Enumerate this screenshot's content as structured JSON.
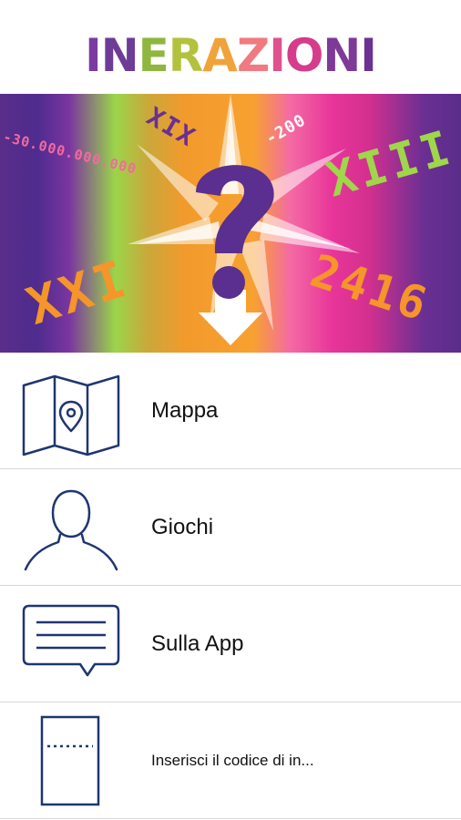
{
  "app": {
    "logo_text": "INERAZIONI",
    "logo_letters": [
      {
        "ch": "I",
        "color": "#7a3aa0"
      },
      {
        "ch": "N",
        "color": "#6d3c97"
      },
      {
        "ch": "E",
        "color": "#8fb63f"
      },
      {
        "ch": "R",
        "color": "#b3c23d"
      },
      {
        "ch": "A",
        "color": "#f0a33b"
      },
      {
        "ch": "Z",
        "color": "#f07a7f"
      },
      {
        "ch": "I",
        "color": "#e0528f"
      },
      {
        "ch": "O",
        "color": "#d53d8c"
      },
      {
        "ch": "N",
        "color": "#7d3a98"
      },
      {
        "ch": "I",
        "color": "#6a3392"
      }
    ]
  },
  "banner": {
    "texts": {
      "neg_big": "-30.000.000.000",
      "xix": "XIX",
      "neg200": "-200",
      "xiii": "XIII",
      "xxi": "XXI",
      "year2416": "2416"
    },
    "colors": {
      "question": "#5a2f8f",
      "star": "#ffffff",
      "pink": "#f26aa0",
      "violet": "#6a2f93",
      "green": "#9fd64a",
      "orange": "#f5952a",
      "white": "#ffffff"
    }
  },
  "menu": {
    "items": [
      {
        "label": "Mappa",
        "icon": "map-icon"
      },
      {
        "label": "Giochi",
        "icon": "user-icon"
      },
      {
        "label": "Sulla App",
        "icon": "chat-icon"
      },
      {
        "label": "Inserisci il codice di in...",
        "icon": "ticket-icon"
      }
    ]
  }
}
